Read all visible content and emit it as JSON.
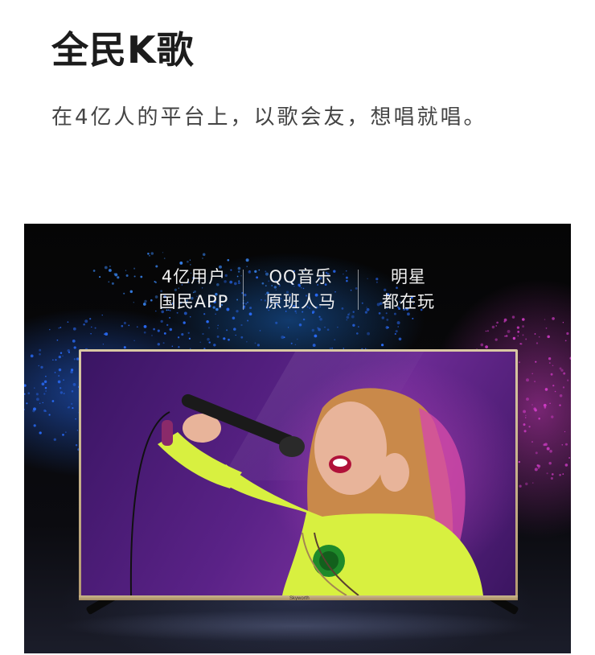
{
  "header": {
    "title": "全民K歌",
    "description": "在4亿人的平台上，以歌会友，想唱就唱。"
  },
  "banner": {
    "features": [
      {
        "line1": "4亿用户",
        "line2": "国民APP"
      },
      {
        "line1": "QQ音乐",
        "line2": "原班人马"
      },
      {
        "line1": "明星",
        "line2": "都在玩"
      }
    ],
    "tv_brand": "Skyworth"
  },
  "colors": {
    "title": "#1c1c1c",
    "text": "#444444",
    "banner_bg": "#050505",
    "powder_blue": "#2a6eff",
    "powder_pink": "#d23cc8",
    "screen_purple": "#5a2287",
    "tv_frame_gold": "#c8b288"
  }
}
